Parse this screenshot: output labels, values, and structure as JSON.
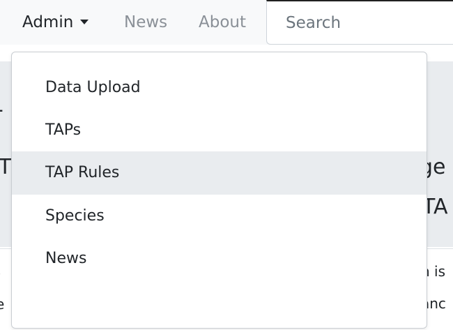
{
  "navbar": {
    "admin_label": "Admin",
    "news_label": "News",
    "about_label": "About",
    "search_placeholder": "Search"
  },
  "dropdown": {
    "items": [
      {
        "label": "Data Upload"
      },
      {
        "label": "TAPs"
      },
      {
        "label": "TAP Rules"
      },
      {
        "label": "Species"
      },
      {
        "label": "News"
      }
    ],
    "highlighted_item": "TAP Rules"
  },
  "background_fragments": {
    "left_1": "-",
    "left_2": "T",
    "left_3": ")",
    "left_4": "e",
    "right_1": "ge",
    "right_2": "TA",
    "right_3": "n is",
    "right_4": "anc"
  },
  "colors": {
    "navbar_bg": "#f8f9fa",
    "muted_link": "#8a9097",
    "highlight": "#e9ecef",
    "text": "#212529"
  }
}
